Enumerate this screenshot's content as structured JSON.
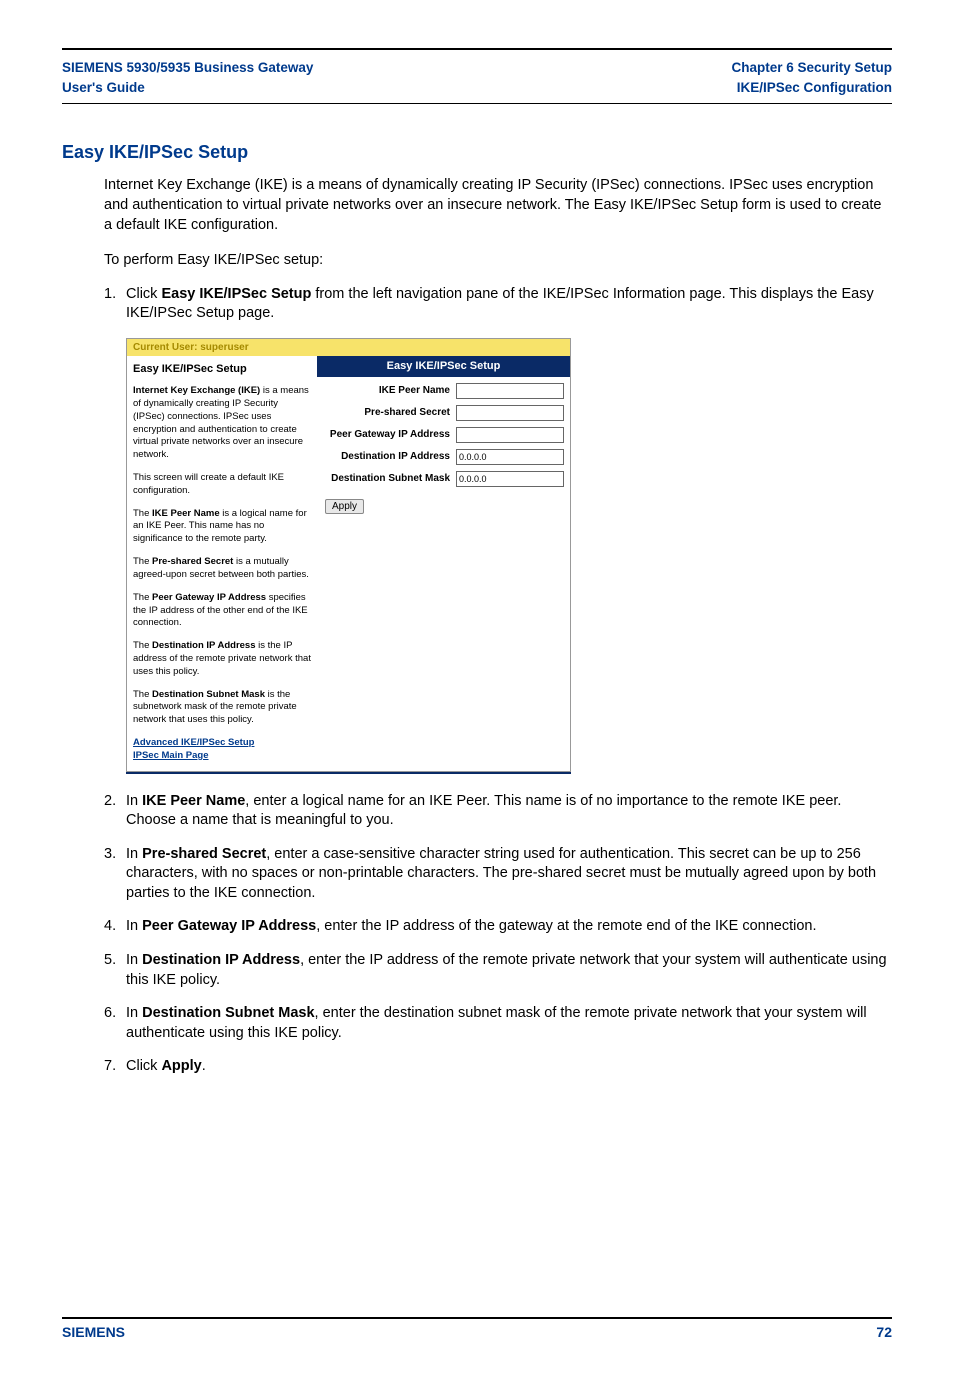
{
  "header": {
    "left_line1": "SIEMENS 5930/5935 Business Gateway",
    "left_line2": "User's Guide",
    "right_line1": "Chapter 6  Security Setup",
    "right_line2": "IKE/IPSec Configuration"
  },
  "section_title": "Easy IKE/IPSec Setup",
  "intro_para": "Internet Key Exchange (IKE) is a means of dynamically creating IP Security (IPSec) connections. IPSec uses encryption and authentication to virtual private networks over an insecure network. The Easy IKE/IPSec Setup form is used to create a default IKE configuration.",
  "intro_lead": "To perform Easy IKE/IPSec setup:",
  "steps": {
    "s1_num": "1.",
    "s1_a": "Click ",
    "s1_b": "Easy IKE/IPSec Setup",
    "s1_c": " from the left navigation pane of the IKE/IPSec Information page. This displays the Easy IKE/IPSec Setup page.",
    "s2_num": "2.",
    "s2_a": "In ",
    "s2_b": "IKE Peer Name",
    "s2_c": ", enter a logical name for an IKE Peer. This name is of no importance to the remote IKE peer. Choose a name that is meaningful to you.",
    "s3_num": "3.",
    "s3_a": "In ",
    "s3_b": "Pre-shared Secret",
    "s3_c": ", enter a case-sensitive character string used for authentication. This secret can be up to 256 characters, with no spaces or non-printable characters. The pre-shared secret must be mutually agreed upon by both parties to the IKE connection.",
    "s4_num": "4.",
    "s4_a": "In ",
    "s4_b": "Peer Gateway IP Address",
    "s4_c": ", enter the IP address of the gateway at the remote end of the IKE connection.",
    "s5_num": "5.",
    "s5_a": "In ",
    "s5_b": "Destination IP Address",
    "s5_c": ", enter the IP address of the remote private network that your system will authenticate using this IKE policy.",
    "s6_num": "6.",
    "s6_a": "In ",
    "s6_b": "Destination Subnet Mask",
    "s6_c": ", enter the destination subnet mask of the remote private network that your system will authenticate using this IKE policy.",
    "s7_num": "7.",
    "s7_a": "Click ",
    "s7_b": "Apply",
    "s7_c": "."
  },
  "embed": {
    "current_user": "Current User: superuser",
    "side_title": "Easy IKE/IPSec Setup",
    "p1a": "Internet Key Exchange (IKE)",
    "p1b": " is a means of dynamically creating IP Security (IPSec) connections. IPSec uses encryption and authentication to create virtual private networks over an insecure network.",
    "p2": "This screen will create a default IKE configuration.",
    "p3a": "The ",
    "p3b": "IKE Peer Name",
    "p3c": " is a logical name for an IKE Peer. This name has no significance to the remote party.",
    "p4a": "The ",
    "p4b": "Pre-shared Secret",
    "p4c": " is a mutually agreed-upon secret between both parties.",
    "p5a": "The ",
    "p5b": "Peer Gateway IP Address",
    "p5c": " specifies the IP address of the other end of the IKE connection.",
    "p6a": "The ",
    "p6b": "Destination IP Address",
    "p6c": " is the IP address of the remote private network that uses this policy.",
    "p7a": "The ",
    "p7b": "Destination Subnet Mask",
    "p7c": " is the subnetwork mask of the remote private network that uses this policy.",
    "link1": "Advanced IKE/IPSec Setup",
    "link2": "IPSec Main Page",
    "form_head": "Easy IKE/IPSec Setup",
    "f1": "IKE Peer Name",
    "f2": "Pre-shared Secret",
    "f3": "Peer Gateway IP Address",
    "f4": "Destination IP Address",
    "f5": "Destination Subnet Mask",
    "v4": "0.0.0.0",
    "v5": "0.0.0.0",
    "apply": "Apply"
  },
  "footer": {
    "left": "SIEMENS",
    "right": "72"
  }
}
